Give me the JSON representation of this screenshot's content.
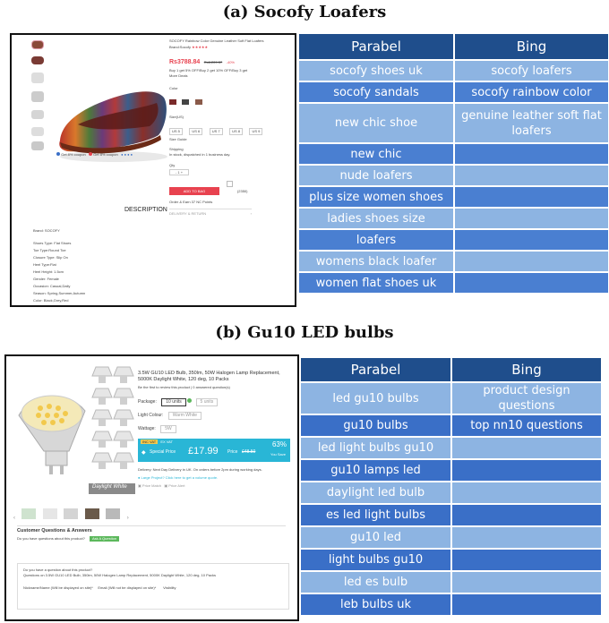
{
  "section_a": {
    "title": "(a) Socofy Loafers",
    "table": {
      "headers": [
        "Parabel",
        "Bing"
      ],
      "rows": [
        [
          "socofy shoes uk",
          "socofy loafers"
        ],
        [
          "socofy sandals",
          "socofy rainbow color"
        ],
        [
          "new chic shoe",
          "genuine leather soft flat loafers"
        ],
        [
          "new chic",
          ""
        ],
        [
          "nude loafers",
          ""
        ],
        [
          "plus size women shoes",
          ""
        ],
        [
          "ladies shoes size",
          ""
        ],
        [
          "loafers",
          ""
        ],
        [
          "womens black loafer",
          ""
        ],
        [
          "women flat shoes uk",
          ""
        ]
      ]
    },
    "product": {
      "title": "SOCOFY Rainbow Color Genuine Leather Soft Flat Loafers",
      "brand": "Brand:Socofy",
      "price": "Rs3788.84",
      "old_price": "Rs6,209.37",
      "discount": "-40%",
      "coupon_line": "Buy 1 get 5% OFF/Buy 2 get 10% OFF/Buy 3 get",
      "more_deals": "More Deals",
      "color_label": "Color",
      "size_label": "Size(US)",
      "sizes": [
        "US 5",
        "US 6",
        "US 7",
        "US 8",
        "US 9"
      ],
      "size_guide": "Size Guide",
      "shipping_label": "Shipping",
      "shipping_text": "In stock, dispatched in 1 business day.",
      "qty_label": "Qty",
      "add_to_bag": "ADD TO BAG",
      "wish_count": "(2350)",
      "points": "Order & Earn 37 NC Points",
      "delivery": "DELIVERY & RETURN",
      "coupon_a": "Get 8% coupon",
      "coupon_b": "Get 8% coupon",
      "description_heading": "DESCRIPTION",
      "brand_line": "Brand: SOCOFY",
      "specs": [
        "Shoes Type: Flat Shoes",
        "Toe Type:Round Toe",
        "Closure Type: Slip On",
        "Heel Type:Flat",
        "Heel Height: 1.5cm",
        "Gender: Female",
        "Occasion: Casual,Daily",
        "Season: Spring,Summer,Autumn",
        "Color: Black,Grey,Red"
      ]
    }
  },
  "section_b": {
    "title": "(b) Gu10 LED bulbs",
    "table": {
      "headers": [
        "Parabel",
        "Bing"
      ],
      "rows": [
        [
          "led gu10 bulbs",
          "product design questions"
        ],
        [
          "gu10 bulbs",
          "top nn10 questions"
        ],
        [
          "led light bulbs gu10",
          ""
        ],
        [
          "gu10 lamps led",
          ""
        ],
        [
          "daylight led bulb",
          ""
        ],
        [
          "es led light bulbs",
          ""
        ],
        [
          "gu10 led",
          ""
        ],
        [
          "light bulbs gu10",
          ""
        ],
        [
          "led es bulb",
          ""
        ],
        [
          "leb bulbs uk",
          ""
        ]
      ]
    },
    "product": {
      "title": "3.5W GU10 LED Bulb, 350lm, 50W Halogen Lamp Replacement, 5000K Daylight White, 120 deg, 10 Packs",
      "review_line": "Be the first to review this product | 0 answered question(s)",
      "package_label": "Package:",
      "package_opts": [
        "10 units",
        "5 units"
      ],
      "light_colour_label": "Light Colour:",
      "light_colour_value": "Warm White",
      "wattage_label": "Wattage:",
      "wattage_value": "5W",
      "vat_inc": "INC VAT",
      "vat_ex": "EX VAT",
      "special_price_label": "Special Price",
      "special_price": "£17.99",
      "price_label": "Price",
      "old_price": "£48.50",
      "save_pct": "63%",
      "you_save": "You Save",
      "image_caption": "Daylight White",
      "delivery": "Delivery: Next Day Delivery in UK. On orders before 2pm during working days.",
      "large_project": "Large Project? Click here to get a volume quote.",
      "price_match": "Price Match",
      "price_alert": "Price Alert",
      "qa_heading": "Customer Questions & Answers",
      "qa_prompt": "Do you have questions about this product?",
      "ask_button": "Ask A Question",
      "qa_box_title": "Do you have a question about this product?",
      "qa_box_line": "Questions on 3.5W GU10 LED Bulb, 350lm, 50W Halogen Lamp Replacement, 5000K Daylight White, 120 deg, 10 Packs",
      "field_nick": "Nickname/Name (Will be displayed on site)*",
      "field_email": "Email (Will not be displayed on site)*",
      "field_visibility": "Visibility"
    }
  },
  "colors": {
    "header_blue": "#1f4e8c",
    "row_light": "#8db4e2",
    "row_dark": "#4a7fd1",
    "add_to_bag": "#e8424f",
    "special_price_bar": "#29b6d6",
    "ask_button": "#5cb85c"
  }
}
